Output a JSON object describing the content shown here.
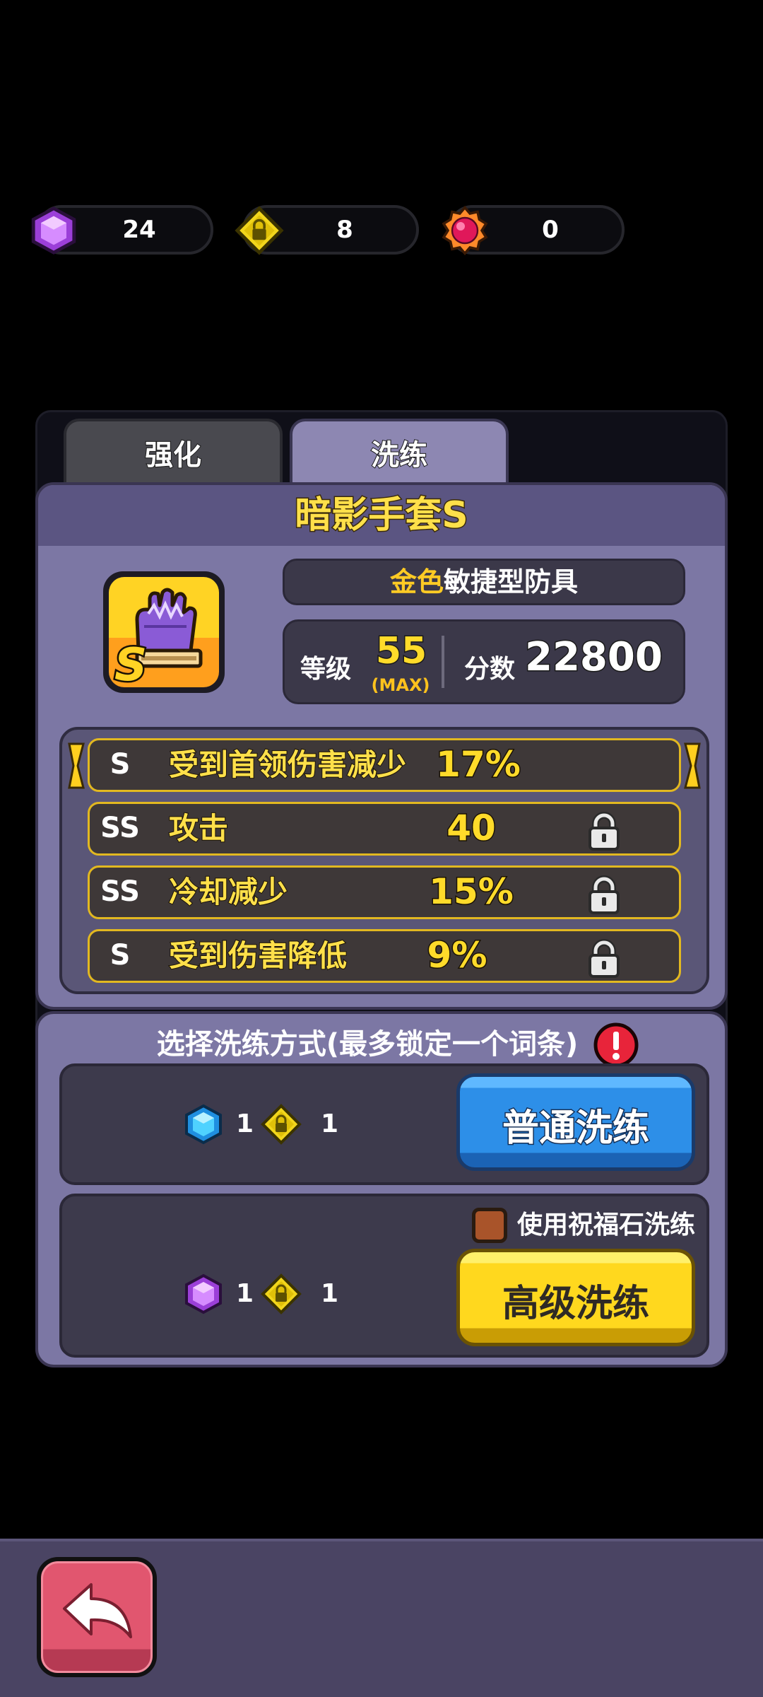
{
  "currencies": [
    {
      "icon": "purple-gem-icon",
      "value": "24"
    },
    {
      "icon": "yellow-lock-stone-icon",
      "value": "8"
    },
    {
      "icon": "pink-orb-icon",
      "value": "0"
    }
  ],
  "tabs": [
    {
      "label": "强化",
      "active": false
    },
    {
      "label": "洗练",
      "active": true
    }
  ],
  "item": {
    "name": "暗影手套S",
    "icon": "purple-gauntlet-icon",
    "grade_badge": "S",
    "type_color_word": "金色",
    "type_rest": "敏捷型防具",
    "level_label": "等级",
    "level_value": "55",
    "level_max": "(MAX)",
    "score_label": "分数",
    "score_value": "22800"
  },
  "attributes": [
    {
      "grade": "S",
      "name": "受到首领伤害减少",
      "value": "17%",
      "highlighted": true,
      "lockable": false
    },
    {
      "grade": "SS",
      "name": "攻击",
      "value": "40",
      "highlighted": false,
      "lockable": true
    },
    {
      "grade": "SS",
      "name": "冷却减少",
      "value": "15%",
      "highlighted": false,
      "lockable": true
    },
    {
      "grade": "S",
      "name": "受到伤害降低",
      "value": "9%",
      "highlighted": false,
      "lockable": true
    }
  ],
  "refine": {
    "hint": "选择洗练方式(最多锁定一个词条)",
    "warning_icon": "!",
    "normal": {
      "cost1_icon": "blue-gem-icon",
      "cost1": "1",
      "cost2_icon": "yellow-lock-stone-icon",
      "cost2": "1",
      "button": "普通洗练"
    },
    "advanced": {
      "checkbox_label": "使用祝福石洗练",
      "cost1_icon": "purple-gem-icon",
      "cost1": "1",
      "cost2_icon": "yellow-lock-stone-icon",
      "cost2": "1",
      "button": "高级洗练"
    }
  },
  "nav": {
    "back_icon": "back-arrow-icon"
  },
  "colors": {
    "accent_gold": "#ffdb2a",
    "panel": "#7c77a4",
    "blue_button": "#2d8fe8",
    "yellow_button": "#ffd81e",
    "back_button": "#e1566f"
  }
}
